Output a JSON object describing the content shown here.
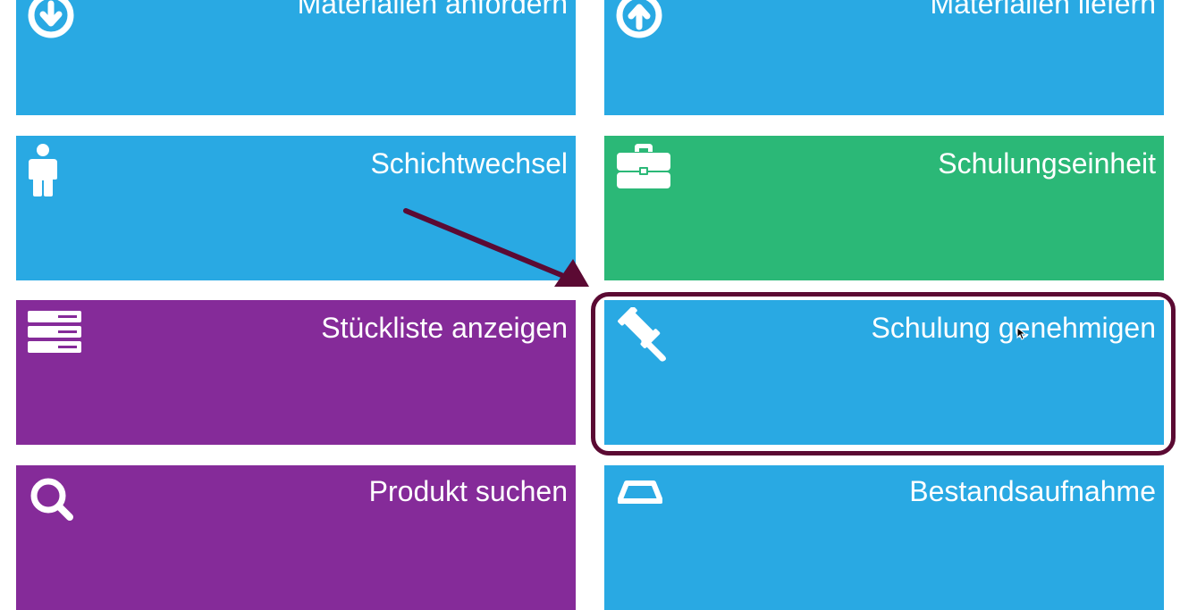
{
  "tiles": [
    {
      "id": "materialien-anfordern",
      "label": "Materialien anfordern",
      "color": "#29a9e3",
      "icon": "arrow-down-circle-icon"
    },
    {
      "id": "materialien-liefern",
      "label": "Materialien liefern",
      "color": "#29a9e3",
      "icon": "arrow-up-circle-icon"
    },
    {
      "id": "schichtwechsel",
      "label": "Schichtwechsel",
      "color": "#29a9e3",
      "icon": "person-icon"
    },
    {
      "id": "schulungseinheit",
      "label": "Schulungseinheit",
      "color": "#2bb877",
      "icon": "briefcase-icon"
    },
    {
      "id": "stueckliste-anzeigen",
      "label": "Stückliste anzeigen",
      "color": "#852b99",
      "icon": "server-list-icon"
    },
    {
      "id": "schulung-genehmigen",
      "label": "Schulung genehmigen",
      "color": "#29a9e3",
      "icon": "gavel-icon"
    },
    {
      "id": "produkt-suchen",
      "label": "Produkt suchen",
      "color": "#852b99",
      "icon": "search-icon"
    },
    {
      "id": "bestandsaufnahme",
      "label": "Bestandsaufnahme",
      "color": "#29a9e3",
      "icon": "cart-icon"
    }
  ],
  "annotation": {
    "color": "#5b0a33",
    "target": "schulung-genehmigen"
  }
}
